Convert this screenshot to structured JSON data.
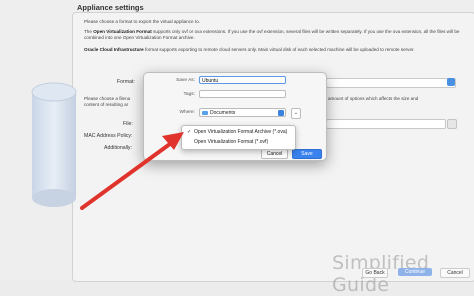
{
  "section": {
    "title": "Appliance settings"
  },
  "description": {
    "p1": "Please choose a format to export the virtual appliance to.",
    "p2_lead": "The ",
    "p2_bold": "Open Virtualization Format",
    "p2_rest": " supports only ovf or ova extensions. If you use the ovf extension, several files will be written separately. If you use the ova extension, all the files will be combined into one Open Virtualization Format archive.",
    "p3_bold": "Oracle Cloud Infrastructure",
    "p3_rest": " format supports exporting to remote cloud servers only. Main virtual disk of each selected machine will be uploaded to remote server.",
    "p4_left": "Please choose a filena",
    "p4_right": "amount of options which affects the size and",
    "p4_line2": "content of resulting ar"
  },
  "form": {
    "format_label": "Format:",
    "file_label": "File:",
    "mac_label": "MAC Address Policy:",
    "additionally_label": "Additionally:"
  },
  "dialog": {
    "save_as_label": "Save As:",
    "save_as_value": "Ubuntu",
    "tags_label": "Tags:",
    "where_label": "Where:",
    "where_value": "Documents",
    "expand_glyph": "⌄",
    "cancel_label": "Cancel",
    "save_label": "Save"
  },
  "format_menu": {
    "items": [
      {
        "label": "Open Virtualization Format Archive (*.ova)",
        "checked": true
      },
      {
        "label": "Open Virtualization Format (*.ovf)",
        "checked": false
      }
    ],
    "check_glyph": "✓"
  },
  "footer": {
    "go_back": "Go Back",
    "continue": "Continue",
    "cancel": "Cancel"
  },
  "watermark": "Simplified Guide",
  "colors": {
    "accent": "#3a82ee",
    "arrow": "#e0332b"
  }
}
